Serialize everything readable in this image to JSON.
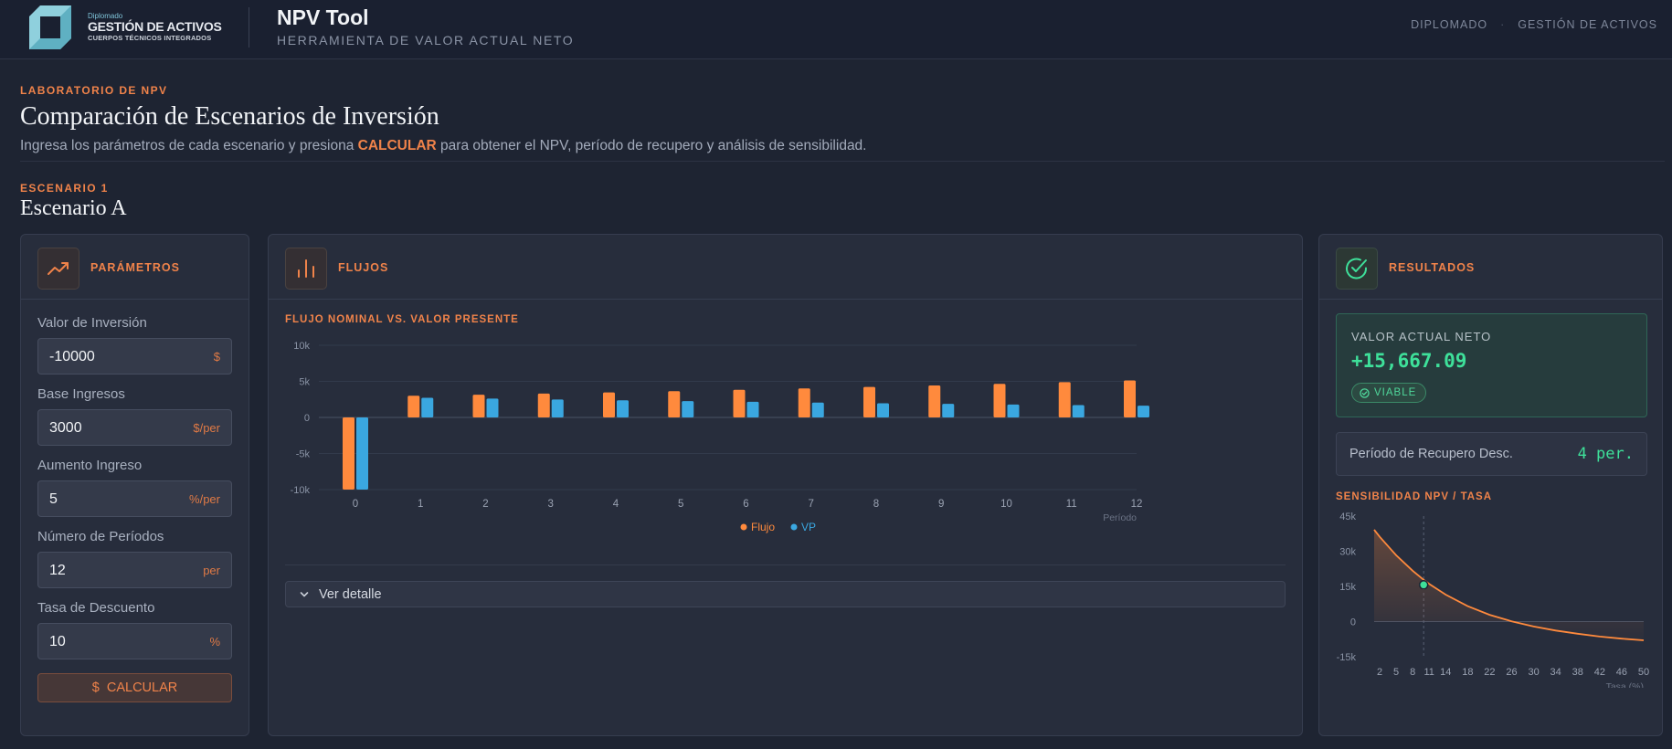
{
  "header": {
    "logo_small": "Diplomado",
    "logo_main": "GESTIÓN DE ACTIVOS",
    "logo_sub": "CUERPOS TÉCNICOS INTEGRADOS",
    "app_title": "NPV Tool",
    "app_subtitle": "HERRAMIENTA DE VALOR ACTUAL NETO",
    "nav": [
      "DIPLOMADO",
      "·",
      "GESTIÓN DE ACTIVOS"
    ]
  },
  "intro": {
    "kicker": "LABORATORIO DE NPV",
    "title": "Comparación de Escenarios de Inversión",
    "lead_before": "Ingresa los parámetros de cada escenario y presiona ",
    "lead_highlight": "CALCULAR",
    "lead_after": " para obtener el NPV, período de recupero y análisis de sensibilidad."
  },
  "scenario": {
    "kicker": "ESCENARIO 1",
    "title": "Escenario A"
  },
  "params": {
    "title": "PARÁMETROS",
    "fields": [
      {
        "label": "Valor de Inversión",
        "value": "-10000",
        "unit": "$"
      },
      {
        "label": "Base Ingresos",
        "value": "3000",
        "unit": "$/per"
      },
      {
        "label": "Aumento Ingreso",
        "value": "5",
        "unit": "%/per"
      },
      {
        "label": "Número de Períodos",
        "value": "12",
        "unit": "per"
      },
      {
        "label": "Tasa de Descuento",
        "value": "10",
        "unit": "%"
      }
    ],
    "calc_icon": "$",
    "calc_label": "CALCULAR"
  },
  "flows": {
    "title": "FLUJOS",
    "chart_title": "FLUJO NOMINAL VS. VALOR PRESENTE",
    "details_label": "Ver detalle"
  },
  "results": {
    "title": "RESULTADOS",
    "npv_label": "VALOR ACTUAL NETO",
    "npv_value": "+15,667.09",
    "badge": "VIABLE",
    "payback_label": "Período de Recupero Desc.",
    "payback_value": "4 per.",
    "sens_title": "SENSIBILIDAD NPV / TASA"
  },
  "colors": {
    "accent": "#f0834a",
    "flow": "#ff8a3d",
    "pv": "#3aa7e0",
    "positive": "#3ee09a"
  },
  "chart_data": [
    {
      "type": "bar",
      "title": "FLUJO NOMINAL VS. VALOR PRESENTE",
      "xlabel": "Período",
      "ylabel": "",
      "categories": [
        "0",
        "1",
        "2",
        "3",
        "4",
        "5",
        "6",
        "7",
        "8",
        "9",
        "10",
        "11",
        "12"
      ],
      "series": [
        {
          "name": "Flujo",
          "color": "#ff8a3d",
          "values": [
            -10000,
            3000,
            3150,
            3308,
            3473,
            3647,
            3829,
            4020,
            4221,
            4432,
            4654,
            4887,
            5131
          ]
        },
        {
          "name": "VP",
          "color": "#3aa7e0",
          "values": [
            -10000,
            2727,
            2603,
            2485,
            2372,
            2264,
            2161,
            2063,
            1969,
            1880,
            1794,
            1713,
            1635
          ]
        }
      ],
      "ylim": [
        -10000,
        10000
      ],
      "yticks": [
        "10k",
        "5k",
        "0",
        "-5k",
        "-10k"
      ],
      "grid": "horizontal",
      "legend": "bottom-center"
    },
    {
      "type": "line",
      "title": "SENSIBILIDAD NPV / TASA",
      "xlabel": "Tasa (%)",
      "ylabel": "",
      "x": [
        1,
        2,
        5,
        8,
        10,
        11,
        14,
        18,
        22,
        26,
        30,
        34,
        38,
        42,
        46,
        50
      ],
      "series": [
        {
          "name": "NPV",
          "color": "#ff8a3d",
          "values": [
            39200,
            36200,
            28300,
            21700,
            17800,
            16100,
            11500,
            6600,
            2900,
            100,
            -2100,
            -3800,
            -5200,
            -6400,
            -7300,
            -8000
          ]
        }
      ],
      "marker": {
        "x": 10,
        "y": 15667
      },
      "xticks": [
        "2",
        "5",
        "8",
        "11",
        "14",
        "18",
        "22",
        "26",
        "30",
        "34",
        "38",
        "42",
        "46",
        "50"
      ],
      "yticks": [
        "45k",
        "30k",
        "15k",
        "0",
        "-15k"
      ],
      "ylim": [
        -15000,
        45000
      ],
      "xlim": [
        1,
        50
      ]
    }
  ]
}
